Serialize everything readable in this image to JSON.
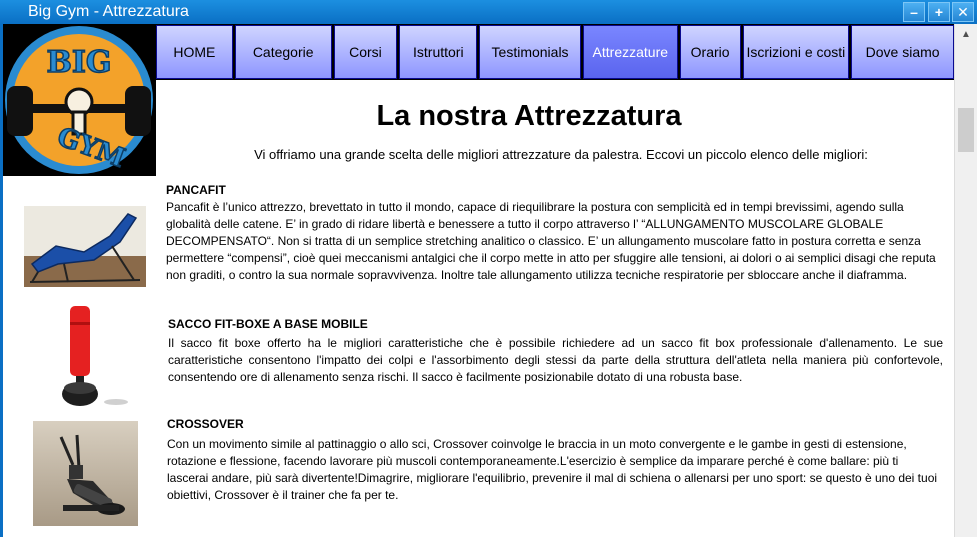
{
  "window": {
    "title": "Big Gym - Attrezzatura",
    "minimize_label": "–",
    "maximize_label": "+",
    "close_label": "✕"
  },
  "logo": {
    "text_top": "BIG",
    "text_bottom": "GYM",
    "colors": {
      "ring": "#2a8bd0",
      "disc": "#f3a22a",
      "background": "#000000"
    }
  },
  "nav": {
    "items": [
      {
        "label": "HOME"
      },
      {
        "label": "Categorie"
      },
      {
        "label": "Corsi"
      },
      {
        "label": "Istruttori"
      },
      {
        "label": "Testimonials"
      },
      {
        "label": "Attrezzature",
        "active": true
      },
      {
        "label": "Orario"
      },
      {
        "label": "Iscrizioni e costi"
      },
      {
        "label": "Dove siamo"
      }
    ]
  },
  "main": {
    "heading": "La nostra Attrezzatura",
    "intro": "Vi offriamo una grande scelta delle migliori attrezzature da palestra. Eccovi un piccolo elenco delle migliori:",
    "items": [
      {
        "title": "PANCAFIT",
        "text": "Pancafit è l’unico attrezzo, brevettato in tutto il mondo, capace di riequilibrare la postura con semplicità ed in tempi brevissimi, agendo sulla globalità delle catene. E’ in grado di ridare libertà e benessere a tutto il corpo attraverso l’ “ALLUNGAMENTO MUSCOLARE GLOBALE DECOMPENSATO“.  Non si tratta di un semplice stretching analitico o classico. E’ un allungamento muscolare fatto in postura corretta e senza permettere “compensi”, cioè quei meccanismi antalgici che il corpo mette in atto per sfuggire alle tensioni, ai dolori o ai semplici disagi che reputa non graditi, o contro la sua normale sopravvivenza. Inoltre tale allungamento utilizza tecniche respiratorie per sbloccare anche il diaframma."
      },
      {
        "title": "SACCO FIT-BOXE A BASE MOBILE",
        "text": "Il sacco fit boxe offerto ha le migliori caratteristiche che è possibile richiedere ad un sacco fit box professionale d'allenamento. Le sue caratteristiche consentono l'impatto dei colpi e l'assorbimento degli stessi da parte della struttura dell'atleta nella maniera più confortevole, consentendo ore di allenamento senza rischi. Il sacco è facilmente posizionabile dotato di una robusta base."
      },
      {
        "title": "CROSSOVER",
        "text": "Con un movimento simile al pattinaggio o allo sci, Crossover coinvolge le braccia in un moto convergente e le gambe in gesti di estensione, rotazione e flessione, facendo lavorare più muscoli contemporaneamente.L'esercizio è semplice da imparare perché è come ballare: più ti lascerai andare, più sarà divertente!Dimagrire, migliorare l'equilibrio, prevenire il mal di schiena o allenarsi per uno sport: se questo è uno dei tuoi obiettivi, Crossover è il trainer che fa per te."
      }
    ]
  }
}
